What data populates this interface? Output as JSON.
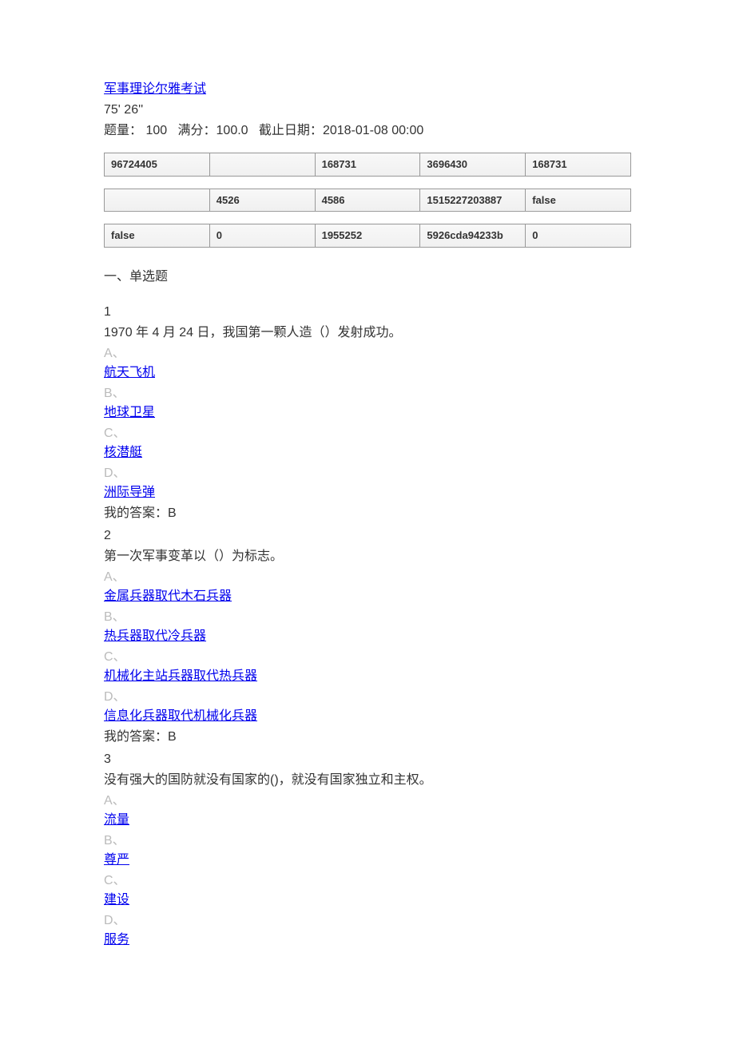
{
  "exam": {
    "title": "军事理论尔雅考试",
    "timer": "75' 26''",
    "meta": {
      "count_label": "题量：",
      "count_value": "100",
      "full_label": "满分：",
      "full_value": "100.0",
      "deadline_label": "截止日期：",
      "deadline_value": "2018-01-08 00:00"
    }
  },
  "tables": [
    {
      "cells": [
        "96724405",
        "",
        "168731",
        "3696430",
        "168731"
      ]
    },
    {
      "cells": [
        "",
        "4526",
        "4586",
        "1515227203887",
        "false"
      ]
    },
    {
      "cells": [
        "false",
        "0",
        "1955252",
        "5926cda94233b",
        "0"
      ]
    }
  ],
  "section_header": "一、单选题",
  "questions": [
    {
      "num": "1",
      "text": "1970 年 4 月 24 日，我国第一颗人造（）发射成功。",
      "options": [
        {
          "letter": "A、",
          "text": "航天飞机"
        },
        {
          "letter": "B、",
          "text": "地球卫星"
        },
        {
          "letter": "C、",
          "text": "核潜艇"
        },
        {
          "letter": "D、",
          "text": "洲际导弹"
        }
      ],
      "answer_label": "我的答案：",
      "answer_value": "B"
    },
    {
      "num": "2",
      "text": "第一次军事变革以（）为标志。",
      "options": [
        {
          "letter": "A、",
          "text": "金属兵器取代木石兵器"
        },
        {
          "letter": "B、",
          "text": "热兵器取代冷兵器"
        },
        {
          "letter": "C、",
          "text": "机械化主站兵器取代热兵器"
        },
        {
          "letter": "D、",
          "text": "信息化兵器取代机械化兵器"
        }
      ],
      "answer_label": "我的答案：",
      "answer_value": "B"
    },
    {
      "num": "3",
      "text": "没有强大的国防就没有国家的()，就没有国家独立和主权。",
      "options": [
        {
          "letter": "A、",
          "text": "流量"
        },
        {
          "letter": "B、",
          "text": "尊严"
        },
        {
          "letter": "C、",
          "text": "建设"
        },
        {
          "letter": "D、",
          "text": "服务"
        }
      ],
      "answer_label": "",
      "answer_value": ""
    }
  ]
}
